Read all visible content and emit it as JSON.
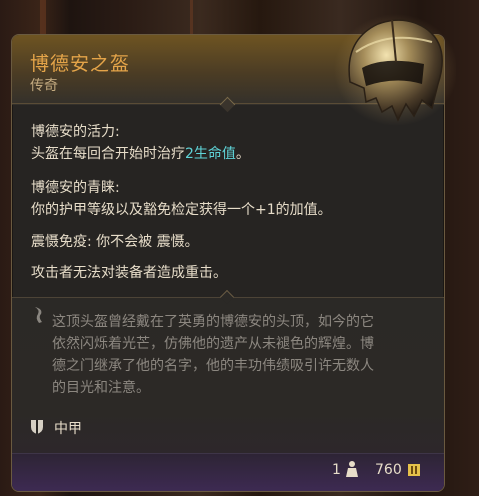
{
  "item": {
    "name": "博德安之盔",
    "rarity": "传奇",
    "rarity_color": "#c2a97f",
    "name_color": "#e4a449"
  },
  "effects": [
    {
      "title": "博德安的活力:",
      "text_before": "头盔在每回合开始时治疗",
      "highlight": "2生命值",
      "text_after": "。",
      "highlight_color": "#5fd4d8"
    },
    {
      "title": "博德安的青睐:",
      "text": "你的护甲等级以及豁免检定获得一个+1的加值。"
    },
    {
      "text": "震慑免疫: 你不会被 震慑。"
    },
    {
      "text": "攻击者无法对装备者造成重击。"
    }
  ],
  "lore": {
    "lines": [
      "这顶头盔曾经戴在了英勇的博德安的头顶，如今的它",
      "依然闪烁着光芒，仿佛他的遗产从未褪色的辉煌。博",
      "德之门继承了他的名字，他的丰功伟绩吸引许无数人",
      "的目光和注意。"
    ],
    "icon": "quill-icon"
  },
  "armor_type": {
    "label": "中甲",
    "icon": "shield-icon"
  },
  "footer": {
    "weight": "1",
    "weight_icon": "weight-icon",
    "price": "760",
    "price_icon": "gold-coin-icon"
  }
}
